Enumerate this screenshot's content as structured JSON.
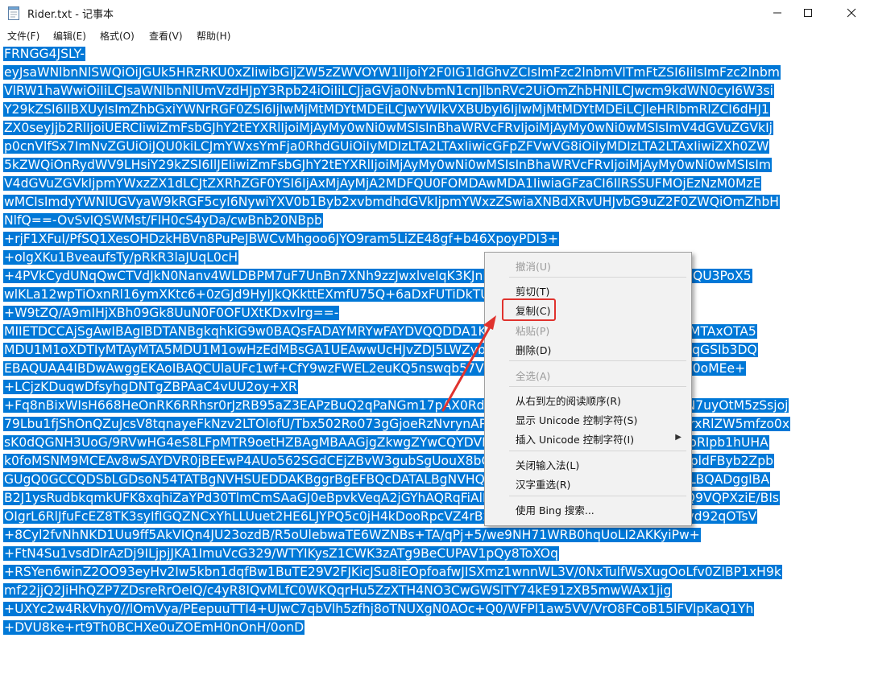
{
  "window": {
    "title": "Rider.txt - 记事本",
    "app_icon": "notepad-icon",
    "controls": [
      "minimize-icon",
      "maximize-icon",
      "close-icon"
    ]
  },
  "menubar": {
    "items": [
      {
        "label": "文件(F)"
      },
      {
        "label": "编辑(E)"
      },
      {
        "label": "格式(O)"
      },
      {
        "label": "查看(V)"
      },
      {
        "label": "帮助(H)"
      }
    ]
  },
  "editor": {
    "selection_color": "#0078d7",
    "lines": [
      "FRNGG4JSLY-",
      "eyJsaWNlbnNlSWQiOiJGUk5HRzRKU0xZIiwibGljZW5zZWVOYW1lIjoiY2F0IG1ldGhvZCIsImFzc2lnbmVlTmFtZSI6IiIsImFzc2lnbm",
      "VlRW1haWwiOiIiLCJsaWNlbnNlUmVzdHJpY3Rpb24iOiIiLCJjaGVja0NvbmN1cnJlbnRVc2UiOmZhbHNlLCJwcm9kdWN0cyI6W3si",
      "Y29kZSI6IlBXUyIsImZhbGxiYWNrRGF0ZSI6IjIwMjMtMDYtMDEiLCJwYWlkVXBUbyI6IjIwMjMtMDYtMDEiLCJleHRlbmRlZCI6dHJ1",
      "ZX0seyJjb2RlIjoiUERCIiwiZmFsbGJhY2tEYXRlIjoiMjAyMy0wNi0wMSIsInBhaWRVcFRvIjoiMjAyMy0wNi0wMSIsImV4dGVuZGVkIj",
      "p0cnVlfSx7ImNvZGUiOiJQU0kiLCJmYWxsYmFja0RhdGUiOiIyMDIzLTA2LTAxIiwicGFpZFVwVG8iOiIyMDIzLTA2LTAxIiwiZXh0ZW",
      "5kZWQiOnRydWV9LHsiY29kZSI6IlJEIiwiZmFsbGJhY2tEYXRlIjoiMjAyMy0wNi0wMSIsInBhaWRVcFRvIjoiMjAyMy0wNi0wMSIsIm",
      "V4dGVuZGVkIjpmYWxzZX1dLCJtZXRhZGF0YSI6IjAxMjAyMjA2MDFQU0FOMDAwMDA1IiwiaGFzaCI6IlRSSUFMOjEzNzM0MzE",
      "wMCIsImdyYWNlUGVyaW9kRGF5cyI6NywiYXV0b1Byb2xvbmdhdGVkIjpmYWxzZSwiaXNBdXRvUHJvbG9uZ2F0ZWQiOmZhbH",
      "NlfQ==-OvSvIQSWMst/FlH0cS4yDa/cwBnb20NBpb",
      "+rjF1XFuI/PfSQ1XesOHDzkHBVn8PuPeJBWCvMhgoo6JYO9ram5LiZE48gf+b46XpoyPDI3+",
      "+olgXKu1BveaufsTy/pRkR3laJUqL0cH",
      "+4PVkCydUNqQwCTVdJkN0Nanv4WLDBPM7uF7UnBn7XNh9zzJwxlveIqK3KJnKcBX+ZWeH0bN4hePXlQDu3Nb7QU3PoX5",
      "wlKLa12wpTiOxnRl16ymXKtc6+0zGJd9HyIJkQKkttEXmfU75Q+6aDxFUTiDkTU2uQAUUuiI",
      "+W9tZQ/A9mIHjXBh09Gk8UuN0F0OFUXtKDxvlrg==-",
      "MIIETDCCAjSgAwIBAgIBDTANBgkqhkiG9w0BAQsFADAYMRYwFAYDVQQDDA1KZXRQcm9maWxlIENBMB4XDTIwMTAxOTA5",
      "MDU1M1oXDTIyMTAyMTA5MDU1M1owHzEdMBsGA1UEAwwUcHJvZDJ5LWZyb20tMjAyMDEwMTkwggEiMA0GCSqGSIb3DQ",
      "EBAQUAA4IBDwAwggEKAoIBAQCUlaUFc1wf+CfY9wzFWEL2euKQ5nswqb57V8QZG7d7RoR6rwYUIXseTOAFq210oMEe+",
      "+LCjzKDuqwDfsyhgDNTgZBPAaC4vUU2oy+XR",
      "+Fq8nBixWIsH668HeOnRK6RRhsr0rJzRB95aZ3EAPzBuQ2qPaNGm17pAX0Rd6MPRgjp75IWwI9eA6aMEdPQEVN7uyOtM5zSsjoj",
      "79Lbu1fjShOnQZuJcsV8tqnayeFkNzv2LTOlofU/Tbx502Ro073gGjoeRzNvrynAP03pL486P3KCAyiNPhDs2z8/COMrxRlZW5mfzo0x",
      "sK0dQGNH3UoG/9RVwHG4eS8LFpMTR9oetHZBAgMBAAGjgZkwgZYwCQYDVR0TBAIwADAdBgNVHQ4EFgQUJNoRIpb1hUHA",
      "k0foMSNM9MCEAv8wSAYDVR0jBEEwP4AUo562SGdCEjZBvW3gubSgUouX8bOhHKQaMBgxFjAUBgNVBAMMDUpldFByb2Zpb",
      "GUgQ0GCCQDSbLGDsoN54TATBgNVHSUEDDAKBggrBgEFBQcDATALBgNVHQ8EBAMCBaAwDQYJKoZIhvcNAQELBQADggIBA",
      "B2J1ysRudbkqmkUFK8xqhiZaYPd30TlmCmSAaGJ0eBpvkVeqA2jGYhAQRqFiAlFC63JKvWvRZO1iRuWCEfUMkdqQ9VQPXziE/BIs",
      "OIgrL6RlJfuFcEZ8TK3syIfIGQZNCxYhLLUuet2HE6LJYPQ5c0jH4kDooRpcVZ4rBxNwddpctUO2te9UU5/FjhioZQsPvd92qOTsV",
      "+8Cyl2fvNhNKD1Uu9ff5AkVIQn4JU23ozdB/R5oUlebwaTE6WZNBs+TA/qPj+5/we9NH71WRB0hqUoLI2AKKyiPw+",
      "+FtN4Su1vsdDlrAzDj9ILjpjJKA1ImuVcG329/WTYIKysZ1CWK3zATg9BeCUPAV1pQy8ToXOq",
      "+RSYen6winZ2OO93eyHv2Iw5kbn1dqfBw1BuTE29V2FJKicJSu8iEOpfoafwJISXmz1wnnWL3V/0NxTulfWsXugOoLfv0ZIBP1xH9k",
      "mf22jjQ2JiHhQZP7ZDsreRrOeIQ/c4yR8IQvMLfC0WKQqrHu5ZzXTH4NO3CwGWSlTY74kE91zXB5mwWAx1jig",
      "+UXYc2w4RkVhy0//lOmVya/PEepuuTTI4+UJwC7qbVlh5zfhj8oTNUXgN0AOc+Q0/WFPl1aw5VV/VrO8FCoB15lFVlpKaQ1Yh",
      "+DVU8ke+rt9Th0BCHXe0uZOEmH0nOnH/0onD"
    ]
  },
  "context_menu": {
    "items": [
      {
        "label": "撤消(U)",
        "enabled": false
      },
      {
        "label": "剪切(T)",
        "enabled": true
      },
      {
        "label": "复制(C)",
        "enabled": true,
        "highlighted": true
      },
      {
        "label": "粘贴(P)",
        "enabled": false
      },
      {
        "label": "删除(D)",
        "enabled": true
      },
      {
        "label": "全选(A)",
        "enabled": false
      },
      {
        "label": "从右到左的阅读顺序(R)",
        "enabled": true
      },
      {
        "label": "显示 Unicode 控制字符(S)",
        "enabled": true
      },
      {
        "label": "插入 Unicode 控制字符(I)",
        "enabled": true,
        "submenu": true
      },
      {
        "label": "关闭输入法(L)",
        "enabled": true
      },
      {
        "label": "汉字重选(R)",
        "enabled": true
      },
      {
        "label": "使用 Bing 搜索...",
        "enabled": true
      }
    ],
    "submenu_indicator": "chevron-right-icon",
    "highlight_color": "#e0332e"
  }
}
